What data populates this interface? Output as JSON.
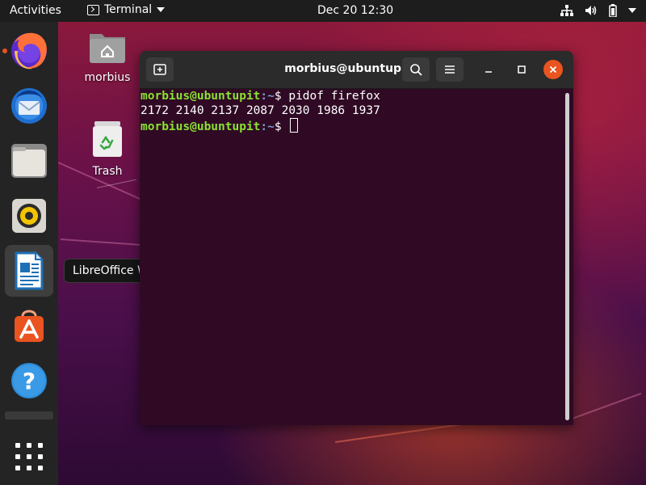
{
  "topbar": {
    "activities": "Activities",
    "app_name": "Terminal",
    "clock": "Dec 20  12:30"
  },
  "dock": {
    "items": [
      {
        "name": "Firefox",
        "running": true
      },
      {
        "name": "Thunderbird",
        "running": false
      },
      {
        "name": "Files",
        "running": false
      },
      {
        "name": "Rhythmbox",
        "running": false
      },
      {
        "name": "LibreOffice Writer",
        "running": false,
        "hovered": true
      },
      {
        "name": "Ubuntu Software",
        "running": false
      },
      {
        "name": "Help",
        "running": false
      },
      {
        "name": "Show Applications",
        "running": false
      }
    ]
  },
  "desktop": {
    "home_label": "morbius",
    "trash_label": "Trash"
  },
  "tooltip": "LibreOffice Writer",
  "terminal": {
    "title": "morbius@ubuntupit: ~",
    "prompt_user": "morbius@ubuntupit",
    "prompt_path": ":~",
    "prompt_symbol": "$ ",
    "command": "pidof firefox",
    "output": "2172 2140 2137 2087 2030 1986 1937"
  },
  "colors": {
    "accent": "#e95420",
    "terminal_bg": "#300a24",
    "prompt_user": "#8ae234",
    "prompt_path": "#729fcf"
  }
}
